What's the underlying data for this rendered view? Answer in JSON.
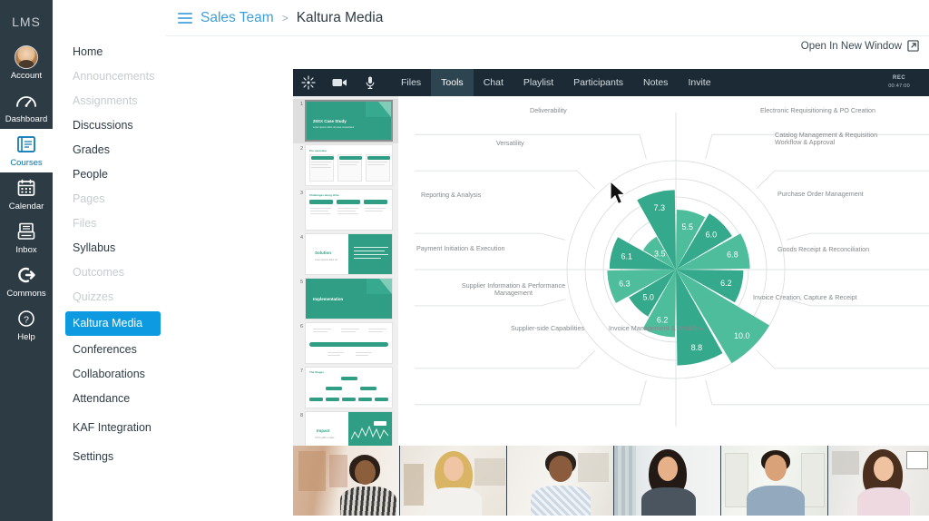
{
  "global_nav": {
    "logo": "LMS",
    "items": [
      {
        "label": "Account",
        "icon": "avatar-icon",
        "active": false
      },
      {
        "label": "Dashboard",
        "icon": "dashboard-icon",
        "active": false
      },
      {
        "label": "Courses",
        "icon": "courses-icon",
        "active": true
      },
      {
        "label": "Calendar",
        "icon": "calendar-icon",
        "active": false
      },
      {
        "label": "Inbox",
        "icon": "inbox-icon",
        "active": false
      },
      {
        "label": "Commons",
        "icon": "commons-icon",
        "active": false
      },
      {
        "label": "Help",
        "icon": "help-icon",
        "active": false
      }
    ]
  },
  "course_nav": {
    "items": [
      {
        "label": "Home",
        "state": "normal"
      },
      {
        "label": "Announcements",
        "state": "disabled"
      },
      {
        "label": "Assignments",
        "state": "disabled"
      },
      {
        "label": "Discussions",
        "state": "normal"
      },
      {
        "label": "Grades",
        "state": "normal"
      },
      {
        "label": "People",
        "state": "normal"
      },
      {
        "label": "Pages",
        "state": "disabled"
      },
      {
        "label": "Files",
        "state": "disabled"
      },
      {
        "label": "Syllabus",
        "state": "normal"
      },
      {
        "label": "Outcomes",
        "state": "disabled"
      },
      {
        "label": "Quizzes",
        "state": "disabled"
      },
      {
        "label": "Kaltura Media",
        "state": "active"
      },
      {
        "label": "Conferences",
        "state": "normal"
      },
      {
        "label": "Collaborations",
        "state": "normal"
      },
      {
        "label": "Attendance",
        "state": "normal"
      },
      {
        "label": "KAF Integration",
        "state": "normal"
      },
      {
        "label": "Settings",
        "state": "normal"
      }
    ]
  },
  "breadcrumb": {
    "course": "Sales Team",
    "separator": ">",
    "current": "Kaltura Media"
  },
  "open_in_new_window": {
    "label": "Open In New Window",
    "icon": "external-link-icon"
  },
  "player": {
    "toolbar": {
      "left_icons": [
        {
          "name": "kaltura-logo-icon"
        },
        {
          "name": "camera-icon"
        },
        {
          "name": "microphone-icon"
        }
      ],
      "tabs": [
        {
          "label": "Files",
          "active": false
        },
        {
          "label": "Tools",
          "active": true
        },
        {
          "label": "Chat",
          "active": false
        },
        {
          "label": "Playlist",
          "active": false
        },
        {
          "label": "Participants",
          "active": false
        },
        {
          "label": "Notes",
          "active": false
        },
        {
          "label": "Invite",
          "active": false
        }
      ],
      "recording": {
        "label": "REC",
        "time": "00:47:00"
      },
      "right_icons": [
        {
          "name": "lock-icon"
        },
        {
          "name": "signal-strength-icon"
        },
        {
          "name": "more-options-icon"
        }
      ]
    },
    "close_button": {
      "name": "close-icon",
      "label": "×"
    },
    "thumbnails": [
      {
        "number": "1",
        "title": "20XX Case Study",
        "selected": true,
        "layout": "title"
      },
      {
        "number": "2",
        "title": "Pro overview",
        "selected": false,
        "layout": "three-cards"
      },
      {
        "number": "3",
        "title": "Challenges along drive",
        "selected": false,
        "layout": "three-pills"
      },
      {
        "number": "4",
        "title": "Solution",
        "selected": false,
        "layout": "split-right"
      },
      {
        "number": "5",
        "title": "Implementation",
        "selected": false,
        "layout": "title"
      },
      {
        "number": "6",
        "title": "",
        "selected": false,
        "layout": "timeline"
      },
      {
        "number": "7",
        "title": "The Stages",
        "selected": false,
        "layout": "org-chart"
      },
      {
        "number": "8",
        "title": "Impact",
        "selected": false,
        "layout": "split-chart"
      }
    ],
    "participants": [
      {
        "name": "participant-tile-1"
      },
      {
        "name": "participant-tile-2"
      },
      {
        "name": "participant-tile-3"
      },
      {
        "name": "participant-tile-4"
      },
      {
        "name": "participant-tile-5"
      },
      {
        "name": "participant-tile-6"
      }
    ]
  },
  "chart_data": {
    "type": "bar",
    "chart_style": "polar-rose",
    "title": "",
    "xlabel": "",
    "ylabel": "",
    "ylim": [
      0,
      10
    ],
    "grid": true,
    "legend": "none",
    "colors": {
      "light": "#4dbd9c",
      "dark": "#35a98c",
      "grid": "#d8dbdd",
      "label": "#85898c"
    },
    "categories": [
      "Electronic Requisitioning & PO Creation",
      "Catalog Management & Requisition Workflow & Approval",
      "Purchase Order Management",
      "Goods Receipt & Reconciliation",
      "Invoice Creation, Capture & Receipt",
      "Invoice Management & Workflow",
      "Supplier-side Capabilities",
      "Supplier Information & Performance Management",
      "Payment Initiation & Execution",
      "Reporting & Analysis",
      "Versatility",
      "Deliverability"
    ],
    "values": [
      5.5,
      6.0,
      6.8,
      6.2,
      10.0,
      8.8,
      6.2,
      5.0,
      6.3,
      6.1,
      3.5,
      7.3
    ],
    "value_labels": [
      "5.5",
      "6.0",
      "6.8",
      "6.2",
      "10.0",
      "8.8",
      "6.2",
      "5.0",
      "6.3",
      "6.1",
      "3.5",
      "7.3"
    ]
  }
}
